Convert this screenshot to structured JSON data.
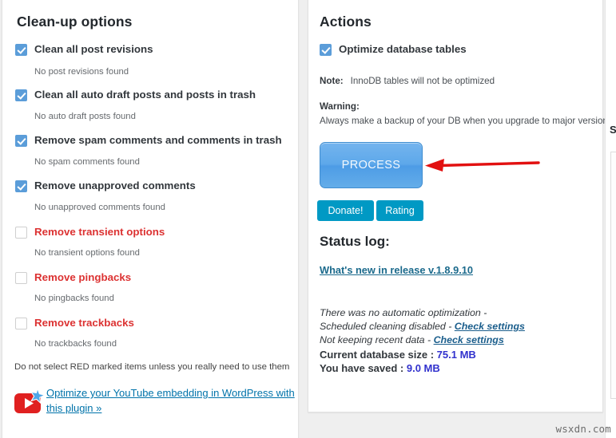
{
  "left_panel": {
    "title": "Clean-up options",
    "options": [
      {
        "label": "Clean all post revisions",
        "checked": true,
        "red": false,
        "note": "No post revisions found"
      },
      {
        "label": "Clean all auto draft posts and posts in trash",
        "checked": true,
        "red": false,
        "note": "No auto draft posts found"
      },
      {
        "label": "Remove spam comments and comments in trash",
        "checked": true,
        "red": false,
        "note": "No spam comments found"
      },
      {
        "label": "Remove unapproved comments",
        "checked": true,
        "red": false,
        "note": "No unapproved comments found"
      },
      {
        "label": "Remove transient options",
        "checked": false,
        "red": true,
        "note": "No transient options found"
      },
      {
        "label": "Remove pingbacks",
        "checked": false,
        "red": true,
        "note": "No pingbacks found"
      },
      {
        "label": "Remove trackbacks",
        "checked": false,
        "red": true,
        "note": "No trackbacks found"
      }
    ],
    "red_warning": "Do not select RED marked items unless you really need to use them",
    "promo_link": "Optimize your YouTube embedding in WordPress with this plugin »"
  },
  "right_panel": {
    "title": "Actions",
    "optimize_checkbox": {
      "label": "Optimize database tables",
      "checked": true
    },
    "note_label": "Note:",
    "note_text": "InnoDB tables will not be optimized",
    "warning_label": "Warning:",
    "warning_text": "Always make a backup of your DB when you upgrade to major versions",
    "process_button": "PROCESS",
    "donate_button": "Donate!",
    "rating_button": "Rating",
    "status": {
      "title": "Status log:",
      "release_link": "What's new in release v.1.8.9.10",
      "line1": "There was no automatic optimization -",
      "line2_text": "Scheduled cleaning disabled - ",
      "line2_link": "Check settings",
      "line3_text": "Not keeping recent data - ",
      "line3_link": "Check settings",
      "db_size_label": "Current database size : ",
      "db_size_value": "75.1 MB",
      "saved_label": "You have saved : ",
      "saved_value": "9.0 MB"
    }
  },
  "edge_panel": {
    "partial_letter": "S"
  },
  "watermark": "wsxdn.com",
  "colors": {
    "checkbox_on": "#5b9dd9",
    "red_option": "#dc3232",
    "teal_button": "#0099c4",
    "process_blue": "#5da8ea",
    "link_blue": "#0073aa",
    "value_blue": "#3232cd",
    "arrow_red": "#e21010"
  }
}
